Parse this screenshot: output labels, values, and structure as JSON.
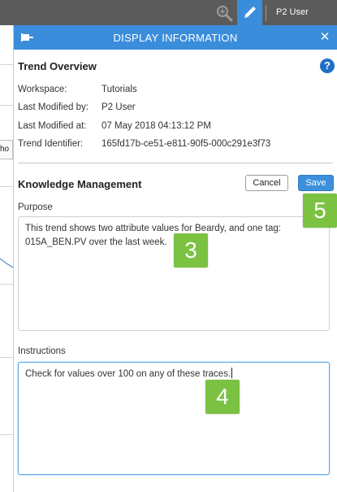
{
  "topbar": {
    "user": "P2 User",
    "icons": {
      "search": "magnify-zoom-icon",
      "edit": "pencil-icon"
    },
    "colors": {
      "bar": "#5b5b5b",
      "active_tool": "#3a8ddb"
    }
  },
  "background": {
    "tab_text": "ho"
  },
  "panel": {
    "title": "DISPLAY INFORMATION",
    "header_color": "#3a8ddb",
    "icons": {
      "pin": "pin-icon",
      "close": "close-icon",
      "help": "help-icon"
    },
    "close_glyph": "✕",
    "help_glyph": "?"
  },
  "overview": {
    "title": "Trend Overview",
    "rows": [
      {
        "label": "Workspace:",
        "value": "Tutorials"
      },
      {
        "label": "Last Modified by:",
        "value": "P2 User"
      },
      {
        "label": "Last Modified at:",
        "value": "07 May 2018 04:13:12 PM"
      },
      {
        "label": "Trend Identifier:",
        "value": "165fd17b-ce51-e811-90f5-000c291e3f73"
      }
    ]
  },
  "knowledge": {
    "title": "Knowledge Management",
    "cancel_label": "Cancel",
    "save_label": "Save",
    "purpose": {
      "label": "Purpose",
      "value": "This trend shows two attribute values for Beardy, and one tag: 015A_BEN.PV over the last week."
    },
    "instructions": {
      "label": "Instructions",
      "value": "Check for values over 100 on any of these traces."
    }
  },
  "callouts": {
    "purpose": "3",
    "instructions": "4",
    "save": "5",
    "color": "#7cc242"
  }
}
